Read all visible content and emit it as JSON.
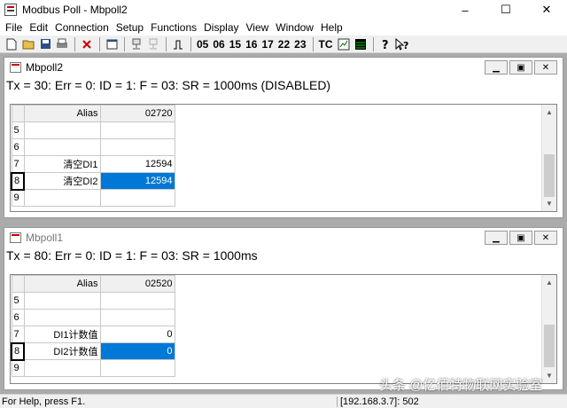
{
  "window": {
    "title": "Modbus Poll - Mbpoll2",
    "min": "–",
    "max": "☐",
    "close": "✕"
  },
  "menu": [
    "File",
    "Edit",
    "Connection",
    "Setup",
    "Functions",
    "Display",
    "View",
    "Window",
    "Help"
  ],
  "toolbar_text": [
    "05",
    "06",
    "15",
    "16",
    "17",
    "22",
    "23",
    "TC"
  ],
  "children": [
    {
      "title": "Mbpoll2",
      "status": "Tx = 30: Err = 0: ID = 1: F = 03: SR = 1000ms  (DISABLED)",
      "header": {
        "alias": "Alias",
        "col": "02720"
      },
      "rows": [
        {
          "num": "5",
          "alias": "",
          "value": ""
        },
        {
          "num": "6",
          "alias": "",
          "value": ""
        },
        {
          "num": "7",
          "alias": "清空DI1",
          "value": "12594"
        },
        {
          "num": "8",
          "alias": "清空DI2",
          "value": "12594"
        },
        {
          "num": "9",
          "alias": "",
          "value": ""
        }
      ]
    },
    {
      "title": "Mbpoll1",
      "status": "Tx = 80: Err = 0: ID = 1: F = 03: SR = 1000ms",
      "header": {
        "alias": "Alias",
        "col": "02520"
      },
      "rows": [
        {
          "num": "5",
          "alias": "",
          "value": ""
        },
        {
          "num": "6",
          "alias": "",
          "value": ""
        },
        {
          "num": "7",
          "alias": "DI1计数值",
          "value": "0"
        },
        {
          "num": "8",
          "alias": "DI2计数值",
          "value": "0"
        },
        {
          "num": "9",
          "alias": "",
          "value": ""
        }
      ]
    }
  ],
  "statusbar": {
    "help": "For Help, press F1.",
    "connection": "[192.168.3.7]: 502"
  },
  "watermark": "头条 @亿佰特物联网实验室"
}
